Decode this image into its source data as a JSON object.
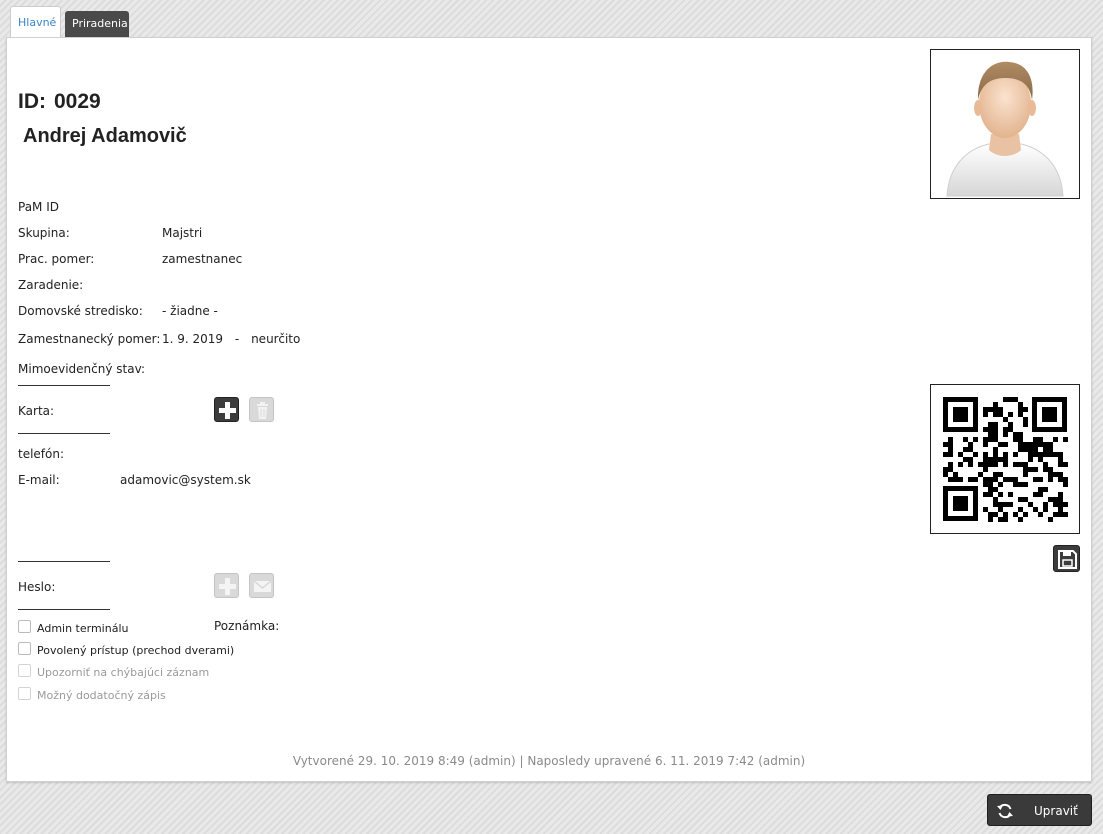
{
  "tabs": [
    {
      "label": "Hlavné",
      "active": true
    },
    {
      "label": "Priradenia",
      "active": false
    }
  ],
  "employee": {
    "id_label": "ID:",
    "id_value": "0029",
    "name": "Andrej Adamovič"
  },
  "fields": {
    "pam_id_label": "PaM ID",
    "skupina_label": "Skupina:",
    "skupina_value": "Majstri",
    "prac_pomer_label": "Prac. pomer:",
    "prac_pomer_value": "zamestnanec",
    "zaradenie_label": "Zaradenie:",
    "domovske_label": "Domovské stredisko:",
    "domovske_value": "- žiadne -",
    "zam_pomer_label": "Zamestnanecký pomer:",
    "zam_pomer_from": "1. 9. 2019",
    "zam_pomer_dash": "-",
    "zam_pomer_to": "neurčito",
    "mimoevid_label": "Mimoevidenčný stav:",
    "karta_label": "Karta:",
    "telefon_label": "telefón:",
    "email_label": "E-mail:",
    "email_value": "adamovic@system.sk",
    "heslo_label": "Heslo:",
    "poznamka_label": "Poznámka:"
  },
  "checkboxes": [
    {
      "label": "Admin terminálu",
      "checked": false,
      "enabled": true
    },
    {
      "label": "Povolený prístup (prechod dverami)",
      "checked": false,
      "enabled": true
    },
    {
      "label": "Upozorniť na chýbajúci záznam",
      "checked": false,
      "enabled": false
    },
    {
      "label": "Možný dodatočný zápis",
      "checked": false,
      "enabled": false
    }
  ],
  "footer": {
    "audit": "Vytvorené 29. 10. 2019 8:49 (admin) | Naposledy upravené 6. 11. 2019 7:42 (admin)"
  },
  "actions": {
    "edit_label": "Upraviť"
  },
  "icons": {
    "add_card": "plus-icon",
    "delete_card": "trash-icon",
    "add_password": "plus-icon",
    "send_password": "envelope-icon",
    "save_qr": "floppy-disk-icon",
    "edit": "refresh-icon"
  },
  "colors": {
    "active_tab_text": "#3a86c8",
    "dark_button": "#3a3a3a",
    "disabled_button": "#d9d9d9"
  }
}
